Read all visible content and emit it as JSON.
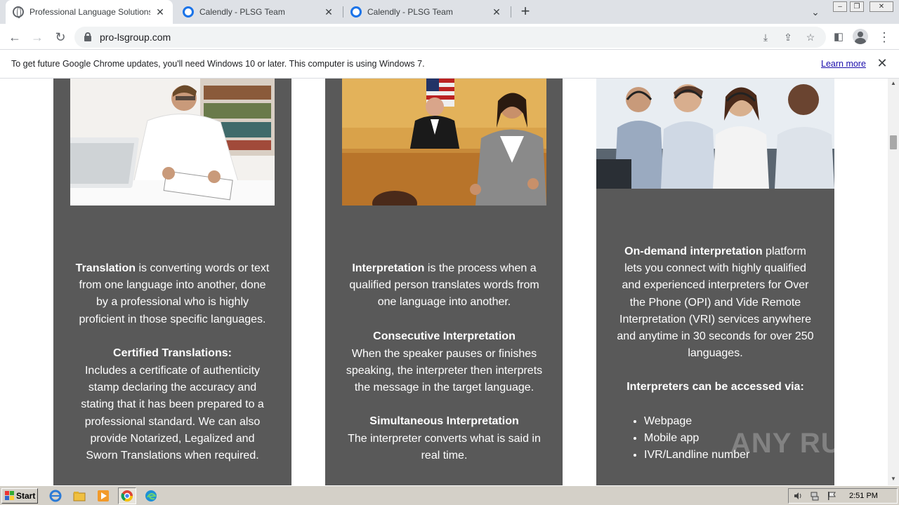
{
  "tabs": [
    {
      "title": "Professional Language Solutions Gro",
      "icon": "globe-icon",
      "active": true
    },
    {
      "title": "Calendly - PLSG Team",
      "icon": "calendly-icon",
      "active": false
    },
    {
      "title": "Calendly - PLSG Team",
      "icon": "calendly-icon",
      "active": false
    }
  ],
  "toolbar": {
    "url": "pro-lsgroup.com"
  },
  "infobar": {
    "message": "To get future Google Chrome updates, you'll need Windows 10 or later. This computer is using Windows 7.",
    "link": "Learn more"
  },
  "cards": {
    "translation": {
      "intro_bold": "Translation",
      "intro_rest": " is converting words or text from one language into another, done by a professional who is highly proficient in those specific languages.",
      "certified_title": "Certified Translations:",
      "certified_body": "Includes a certificate of authenticity stamp declaring the accuracy and stating that it has been prepared to a professional standard. We can also provide Notarized, Legalized  and Sworn Translations when required."
    },
    "interpretation": {
      "intro_bold": "Interpretation",
      "intro_rest": " is the process when a qualified person translates words from one language into another.",
      "consecutive_title": "Consecutive Interpretation",
      "consecutive_body": "When the speaker pauses or finishes speaking, the interpreter then interprets the message in the target language.",
      "simultaneous_title": "Simultaneous Interpretation",
      "simultaneous_body": "The interpreter converts what is said in real time."
    },
    "ondemand": {
      "intro_bold": "On-demand interpretation",
      "intro_rest": " platform lets you connect with highly qualified and experienced interpreters for Over the Phone (OPI) and Vide Remote Interpretation (VRI) services anywhere and anytime in 30 seconds for over 250 languages.",
      "access_title": "Interpreters can be accessed via:",
      "access_items": [
        "Webpage",
        "Mobile app",
        "IVR/Landline number"
      ]
    }
  },
  "taskbar": {
    "start_label": "Start",
    "clock": "2:51 PM"
  },
  "watermark": "ANY RUN"
}
